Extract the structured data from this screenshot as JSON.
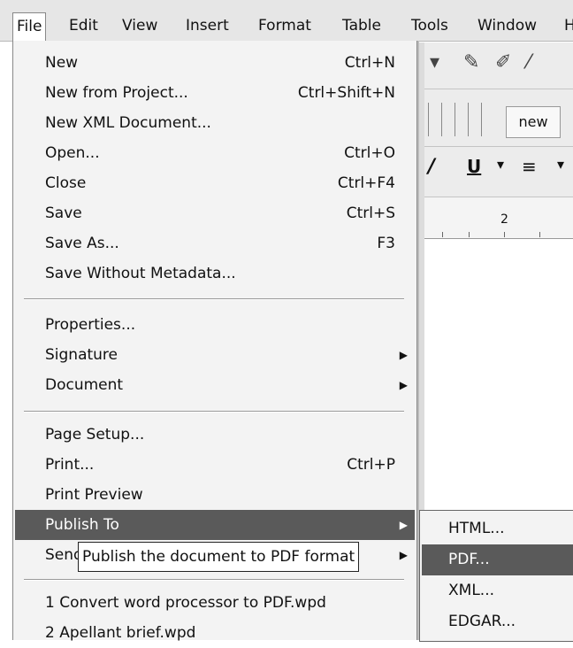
{
  "menubar": {
    "items": [
      "File",
      "Edit",
      "View",
      "Insert",
      "Format",
      "Table",
      "Tools",
      "Window"
    ],
    "cut_label": "H"
  },
  "background": {
    "toolbar_new_label": "new",
    "ruler_mark": "2"
  },
  "file_menu": {
    "groups": [
      [
        {
          "label": "New",
          "shortcut": "Ctrl+N"
        },
        {
          "label": "New from Project...",
          "shortcut": "Ctrl+Shift+N"
        },
        {
          "label": "New XML Document...",
          "shortcut": ""
        },
        {
          "label": "Open...",
          "shortcut": "Ctrl+O"
        },
        {
          "label": "Close",
          "shortcut": "Ctrl+F4"
        },
        {
          "label": "Save",
          "shortcut": "Ctrl+S"
        },
        {
          "label": "Save As...",
          "shortcut": "F3"
        },
        {
          "label": "Save Without Metadata...",
          "shortcut": ""
        }
      ],
      [
        {
          "label": "Properties...",
          "shortcut": ""
        },
        {
          "label": "Signature",
          "shortcut": "",
          "submenu": true
        },
        {
          "label": "Document",
          "shortcut": "",
          "submenu": true
        }
      ],
      [
        {
          "label": "Page Setup...",
          "shortcut": ""
        },
        {
          "label": "Print...",
          "shortcut": "Ctrl+P"
        },
        {
          "label": "Print Preview",
          "shortcut": ""
        },
        {
          "label": "Publish To",
          "shortcut": "",
          "submenu": true,
          "highlighted": true
        },
        {
          "label": "Send",
          "shortcut": "",
          "submenu": true
        }
      ],
      [
        {
          "label": "1 Convert word processor to PDF.wpd",
          "shortcut": ""
        },
        {
          "label": "2 Apellant brief.wpd",
          "shortcut": ""
        }
      ]
    ]
  },
  "tooltip": {
    "text": "Publish the document to PDF format"
  },
  "publish_submenu": {
    "items": [
      {
        "label": "HTML...",
        "highlighted": false
      },
      {
        "label": "PDF...",
        "highlighted": true
      },
      {
        "label": "XML...",
        "highlighted": false
      },
      {
        "label": "EDGAR...",
        "highlighted": false
      }
    ]
  },
  "colors": {
    "highlight": "#5a5a5a",
    "menu_bg": "#f3f3f3",
    "menubar_bg": "#e6e6e6"
  }
}
